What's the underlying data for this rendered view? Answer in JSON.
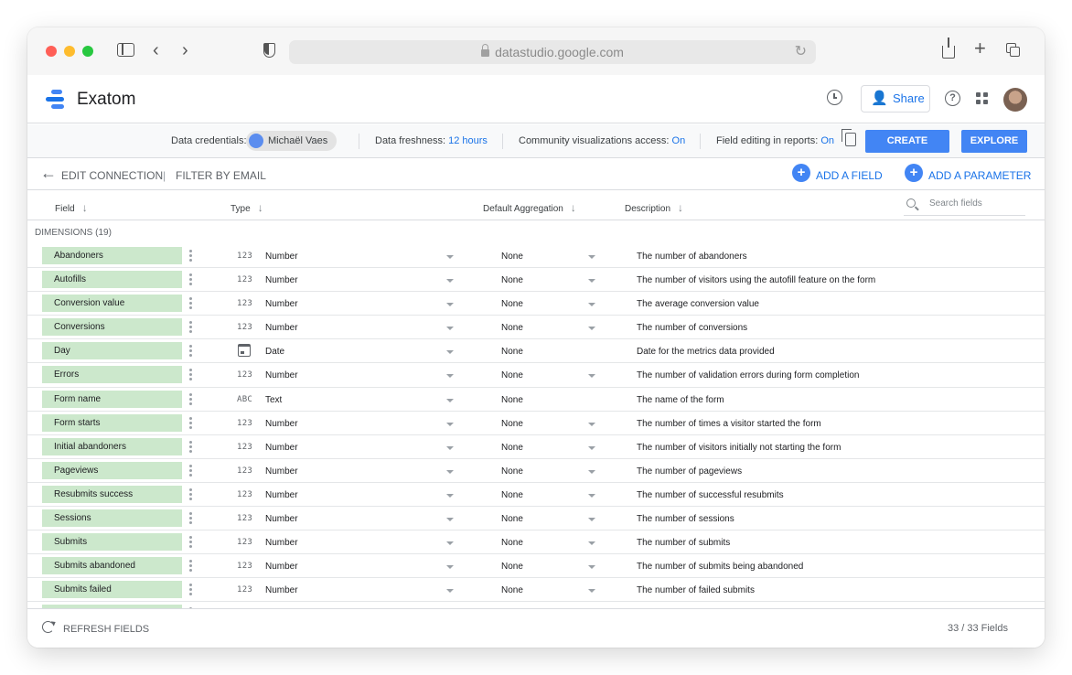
{
  "browser": {
    "url": "datastudio.google.com",
    "traffic_lights": [
      "#ff5f57",
      "#febc2e",
      "#28c840"
    ]
  },
  "app": {
    "title": "Exatom",
    "share_label": "Share",
    "logo_colors": [
      "#4285f4",
      "#1a73e8",
      "#4285f4"
    ]
  },
  "credentials": {
    "data_credentials_label": "Data credentials:",
    "owner": "Michaël Vaes",
    "freshness_label": "Data freshness:",
    "freshness_value": "12 hours",
    "community_label": "Community visualizations access:",
    "community_value": "On",
    "field_editing_label": "Field editing in reports:",
    "field_editing_value": "On",
    "create_report": "CREATE REPORT",
    "explore": "EXPLORE"
  },
  "toolbar": {
    "edit_connection": "EDIT CONNECTION",
    "separator": "|",
    "filter_label": "FILTER BY EMAIL",
    "add_field": "ADD A FIELD",
    "add_parameter": "ADD A PARAMETER"
  },
  "columns": {
    "field": "Field",
    "type": "Type",
    "aggregation": "Default Aggregation",
    "description": "Description",
    "search_placeholder": "Search fields"
  },
  "section_label": "DIMENSIONS (19)",
  "rows": [
    {
      "name": "Abandoners",
      "type_icon": "123",
      "type": "Number",
      "agg": "None",
      "agg_caret": true,
      "desc": "The number of abandoners"
    },
    {
      "name": "Autofills",
      "type_icon": "123",
      "type": "Number",
      "agg": "None",
      "agg_caret": true,
      "desc": "The number of visitors using the autofill feature on the form"
    },
    {
      "name": "Conversion value",
      "type_icon": "123",
      "type": "Number",
      "agg": "None",
      "agg_caret": true,
      "desc": "The average conversion value"
    },
    {
      "name": "Conversions",
      "type_icon": "123",
      "type": "Number",
      "agg": "None",
      "agg_caret": true,
      "desc": "The number of conversions"
    },
    {
      "name": "Day",
      "type_icon": "calendar",
      "type": "Date",
      "agg": "None",
      "agg_caret": false,
      "desc": "Date for the metrics data provided"
    },
    {
      "name": "Errors",
      "type_icon": "123",
      "type": "Number",
      "agg": "None",
      "agg_caret": true,
      "desc": "The number of validation errors during form completion"
    },
    {
      "name": "Form name",
      "type_icon": "ABC",
      "type": "Text",
      "agg": "None",
      "agg_caret": false,
      "desc": "The name of the form"
    },
    {
      "name": "Form starts",
      "type_icon": "123",
      "type": "Number",
      "agg": "None",
      "agg_caret": true,
      "desc": "The number of times a visitor started the form"
    },
    {
      "name": "Initial abandoners",
      "type_icon": "123",
      "type": "Number",
      "agg": "None",
      "agg_caret": true,
      "desc": "The number of visitors initially not starting the form"
    },
    {
      "name": "Pageviews",
      "type_icon": "123",
      "type": "Number",
      "agg": "None",
      "agg_caret": true,
      "desc": "The number of pageviews"
    },
    {
      "name": "Resubmits success",
      "type_icon": "123",
      "type": "Number",
      "agg": "None",
      "agg_caret": true,
      "desc": "The number of successful resubmits"
    },
    {
      "name": "Sessions",
      "type_icon": "123",
      "type": "Number",
      "agg": "None",
      "agg_caret": true,
      "desc": "The number of sessions"
    },
    {
      "name": "Submits",
      "type_icon": "123",
      "type": "Number",
      "agg": "None",
      "agg_caret": true,
      "desc": "The number of submits"
    },
    {
      "name": "Submits abandoned",
      "type_icon": "123",
      "type": "Number",
      "agg": "None",
      "agg_caret": true,
      "desc": "The number of submits being abandoned"
    },
    {
      "name": "Submits failed",
      "type_icon": "123",
      "type": "Number",
      "agg": "None",
      "agg_caret": true,
      "desc": "The number of failed submits"
    },
    {
      "name": "",
      "type_icon": "",
      "type": "",
      "agg": "",
      "agg_caret": false,
      "desc": ""
    }
  ],
  "footer": {
    "refresh": "REFRESH FIELDS",
    "count": "33 / 33 Fields"
  }
}
